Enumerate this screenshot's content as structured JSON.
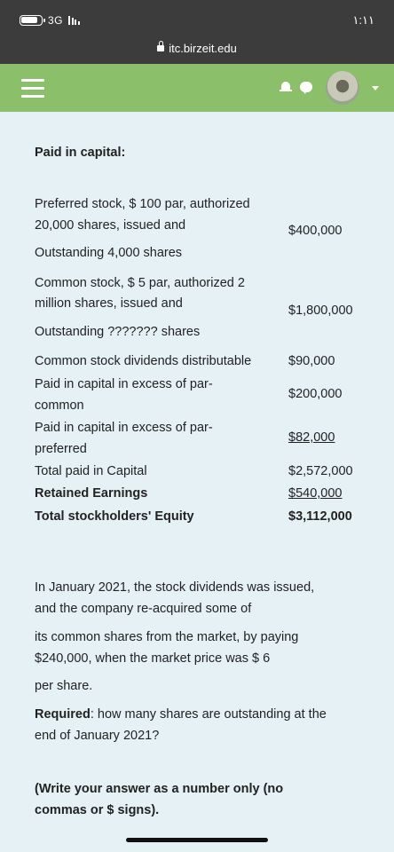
{
  "status_bar": {
    "network": "3G",
    "time": "١:١١"
  },
  "browser": {
    "url": "itc.birzeit.edu"
  },
  "appbar": {
    "menu_icon": "hamburger-icon",
    "notification_icon": "bell-icon",
    "message_icon": "chat-icon",
    "user_menu_icon": "chevron-down-icon"
  },
  "content": {
    "heading": "Paid in capital:",
    "preferred": {
      "line1": "Preferred stock, $ 100 par, authorized",
      "line2": "20,000 shares, issued and",
      "line3": "Outstanding 4,000 shares",
      "value": "$400,000"
    },
    "common": {
      "line1": "Common stock, $ 5 par, authorized 2",
      "line2": "million shares, issued and",
      "line3": "Outstanding ??????? shares",
      "value": "$1,800,000"
    },
    "dividends": {
      "label": "Common stock dividends distributable",
      "value": "$90,000"
    },
    "excess_common": {
      "line1": "Paid in capital in excess of par-",
      "line2": "common",
      "value": "$200,000"
    },
    "excess_preferred": {
      "line1": "Paid in capital in excess of par-",
      "line2": "preferred",
      "value": "$82,000"
    },
    "total_paid": {
      "label": "Total paid in Capital",
      "value": "$2,572,000"
    },
    "retained": {
      "label": "Retained Earnings",
      "value": "$540,000"
    },
    "total_equity": {
      "label": "Total stockholders' Equity",
      "value": "$3,112,000"
    },
    "question": {
      "p1_line1": "In January 2021, the stock dividends was issued,",
      "p1_line2": "and the company re-acquired some of",
      "p2_line1": "its common shares from the market, by paying",
      "p2_line2": "$240,000, when the market price was $ 6",
      "p3": "per share.",
      "required_label": "Required",
      "required_line1": ": how many shares are outstanding at the",
      "required_line2": "end of January 2021?",
      "note_line1": "(Write your answer as a number only (no",
      "note_line2": "commas or $ signs)."
    }
  }
}
